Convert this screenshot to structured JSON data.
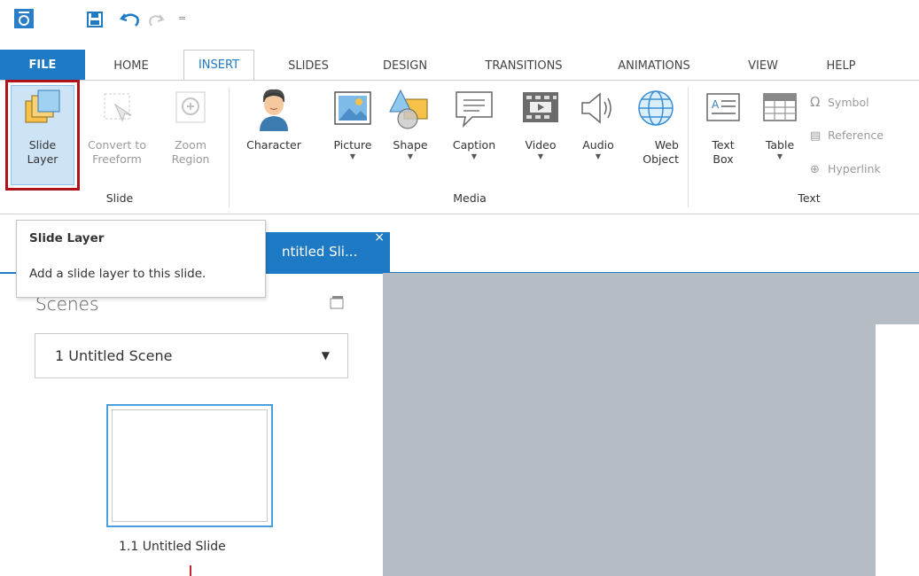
{
  "quick_access": {
    "app_icon": "storyline-app-icon",
    "save_icon": "save-icon",
    "undo_icon": "undo-icon",
    "redo_icon": "redo-icon",
    "customize_icon": "customize-qat-icon"
  },
  "ribbon_tabs": {
    "file": "FILE",
    "home": "HOME",
    "insert": "INSERT",
    "slides": "SLIDES",
    "design": "DESIGN",
    "transitions": "TRANSITIONS",
    "animations": "ANIMATIONS",
    "view": "VIEW",
    "help": "HELP"
  },
  "ribbon": {
    "slide_layer": [
      "Slide",
      "Layer"
    ],
    "convert_to_freeform": [
      "Convert to",
      "Freeform"
    ],
    "zoom_region": [
      "Zoom",
      "Region"
    ],
    "character": "Character",
    "picture": "Picture",
    "shape": "Shape",
    "caption": "Caption",
    "video": "Video",
    "audio": "Audio",
    "web_object": [
      "Web",
      "Object"
    ],
    "text_box": [
      "Text",
      "Box"
    ],
    "table": "Table",
    "symbol": "Symbol",
    "reference": "Reference",
    "hyperlink": "Hyperlink",
    "groups": {
      "slide": "Slide",
      "media": "Media",
      "text": "Text"
    }
  },
  "tooltip": {
    "title": "Slide Layer",
    "description": "Add a slide layer to this slide."
  },
  "document_tab": {
    "label": "ntitled Sli...",
    "close": "×"
  },
  "scenes_panel": {
    "title": "Scenes",
    "scene_selector_value": "1 Untitled Scene",
    "slide_thumbnail_label": "1.1 Untitled Slide"
  },
  "colors": {
    "accent": "#1e7ac4",
    "highlight_border": "#b0121b",
    "canvas": "#b5bcc4"
  }
}
